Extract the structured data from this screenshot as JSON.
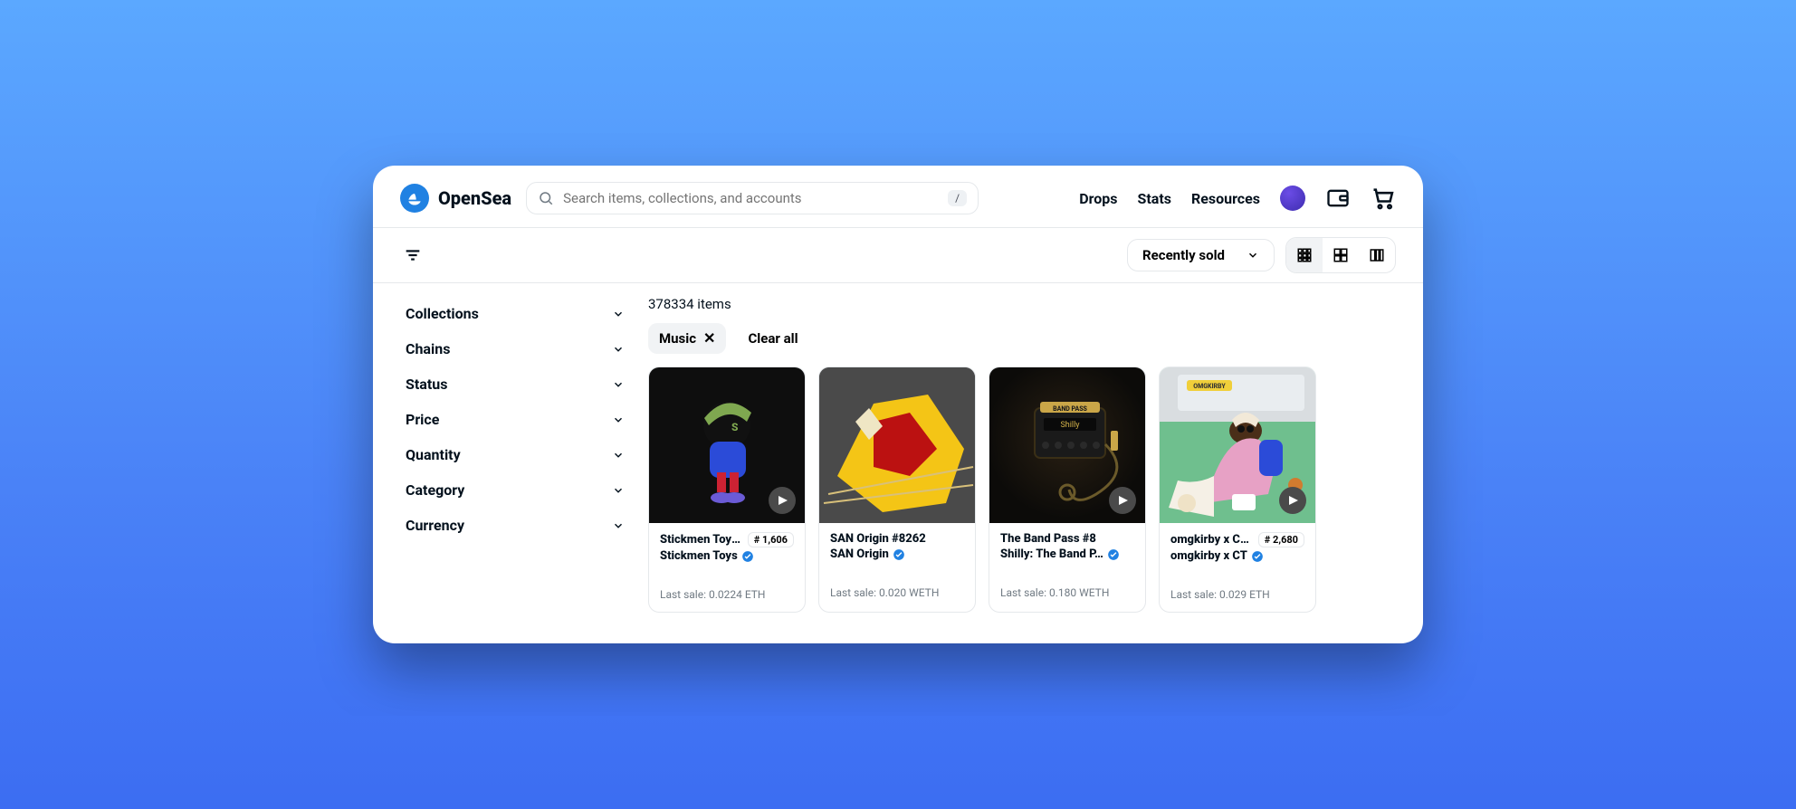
{
  "brand": "OpenSea",
  "search": {
    "placeholder": "Search items, collections, and accounts",
    "kbd": "/"
  },
  "nav": {
    "drops": "Drops",
    "stats": "Stats",
    "resources": "Resources"
  },
  "sort": {
    "label": "Recently sold"
  },
  "sidebar": {
    "items": [
      {
        "label": "Collections"
      },
      {
        "label": "Chains"
      },
      {
        "label": "Status"
      },
      {
        "label": "Price"
      },
      {
        "label": "Quantity"
      },
      {
        "label": "Category"
      },
      {
        "label": "Currency"
      }
    ]
  },
  "results": {
    "count_text": "378334 items"
  },
  "chips": {
    "music": "Music",
    "clear": "Clear all"
  },
  "tiles": [
    {
      "name": "Stickmen Toy #…",
      "badge": "# 1,606",
      "collection": "Stickmen Toys",
      "last": "Last sale: 0.0224 ETH",
      "has_play": true
    },
    {
      "name": "SAN Origin #8262",
      "badge": "",
      "collection": "SAN Origin",
      "last": "Last sale: 0.020 WETH",
      "has_play": false
    },
    {
      "name": "The Band Pass #8",
      "badge": "",
      "collection": "Shilly: The Band P…",
      "last": "Last sale: 0.180 WETH",
      "has_play": true
    },
    {
      "name": "omgkirby x Ch…",
      "badge": "# 2,680",
      "collection": "omgkirby x CT",
      "last": "Last sale: 0.029 ETH",
      "has_play": true
    }
  ]
}
